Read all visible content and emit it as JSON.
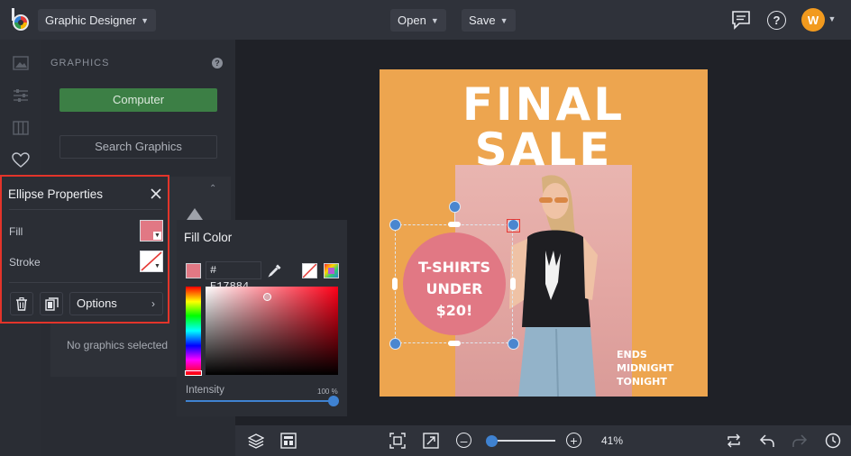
{
  "topbar": {
    "app_mode": "Graphic Designer",
    "open_label": "Open",
    "save_label": "Save",
    "avatar_initial": "W",
    "avatar_color": "#f29a1e"
  },
  "graphics_panel": {
    "title": "GRAPHICS",
    "help": "?",
    "computer_button": "Computer",
    "search_button": "Search Graphics",
    "empty_state": "No graphics selected"
  },
  "ellipse_properties": {
    "title": "Ellipse Properties",
    "fill_label": "Fill",
    "stroke_label": "Stroke",
    "options_label": "Options",
    "fill_color": "#e17884"
  },
  "fill_color": {
    "title": "Fill Color",
    "hex_prefix": "#",
    "hex_value": "E17884",
    "intensity_label": "Intensity",
    "intensity_value": "100 %"
  },
  "canvas": {
    "headline_1": "FINAL",
    "headline_2": "SALE",
    "badge_line_1": "T-SHIRTS",
    "badge_line_2": "UNDER",
    "badge_line_3": "$20!",
    "footer_line_1": "ENDS",
    "footer_line_2": "MIDNIGHT",
    "footer_line_3": "TONIGHT",
    "background_color": "#eda54f",
    "badge_color": "#e17884"
  },
  "bottombar": {
    "zoom_value": "41%",
    "zoom_fraction": 0.05
  },
  "colors": {
    "accent_blue": "#3f82d1",
    "computer_green": "#3c7f45",
    "highlight_red": "#e3342a"
  }
}
